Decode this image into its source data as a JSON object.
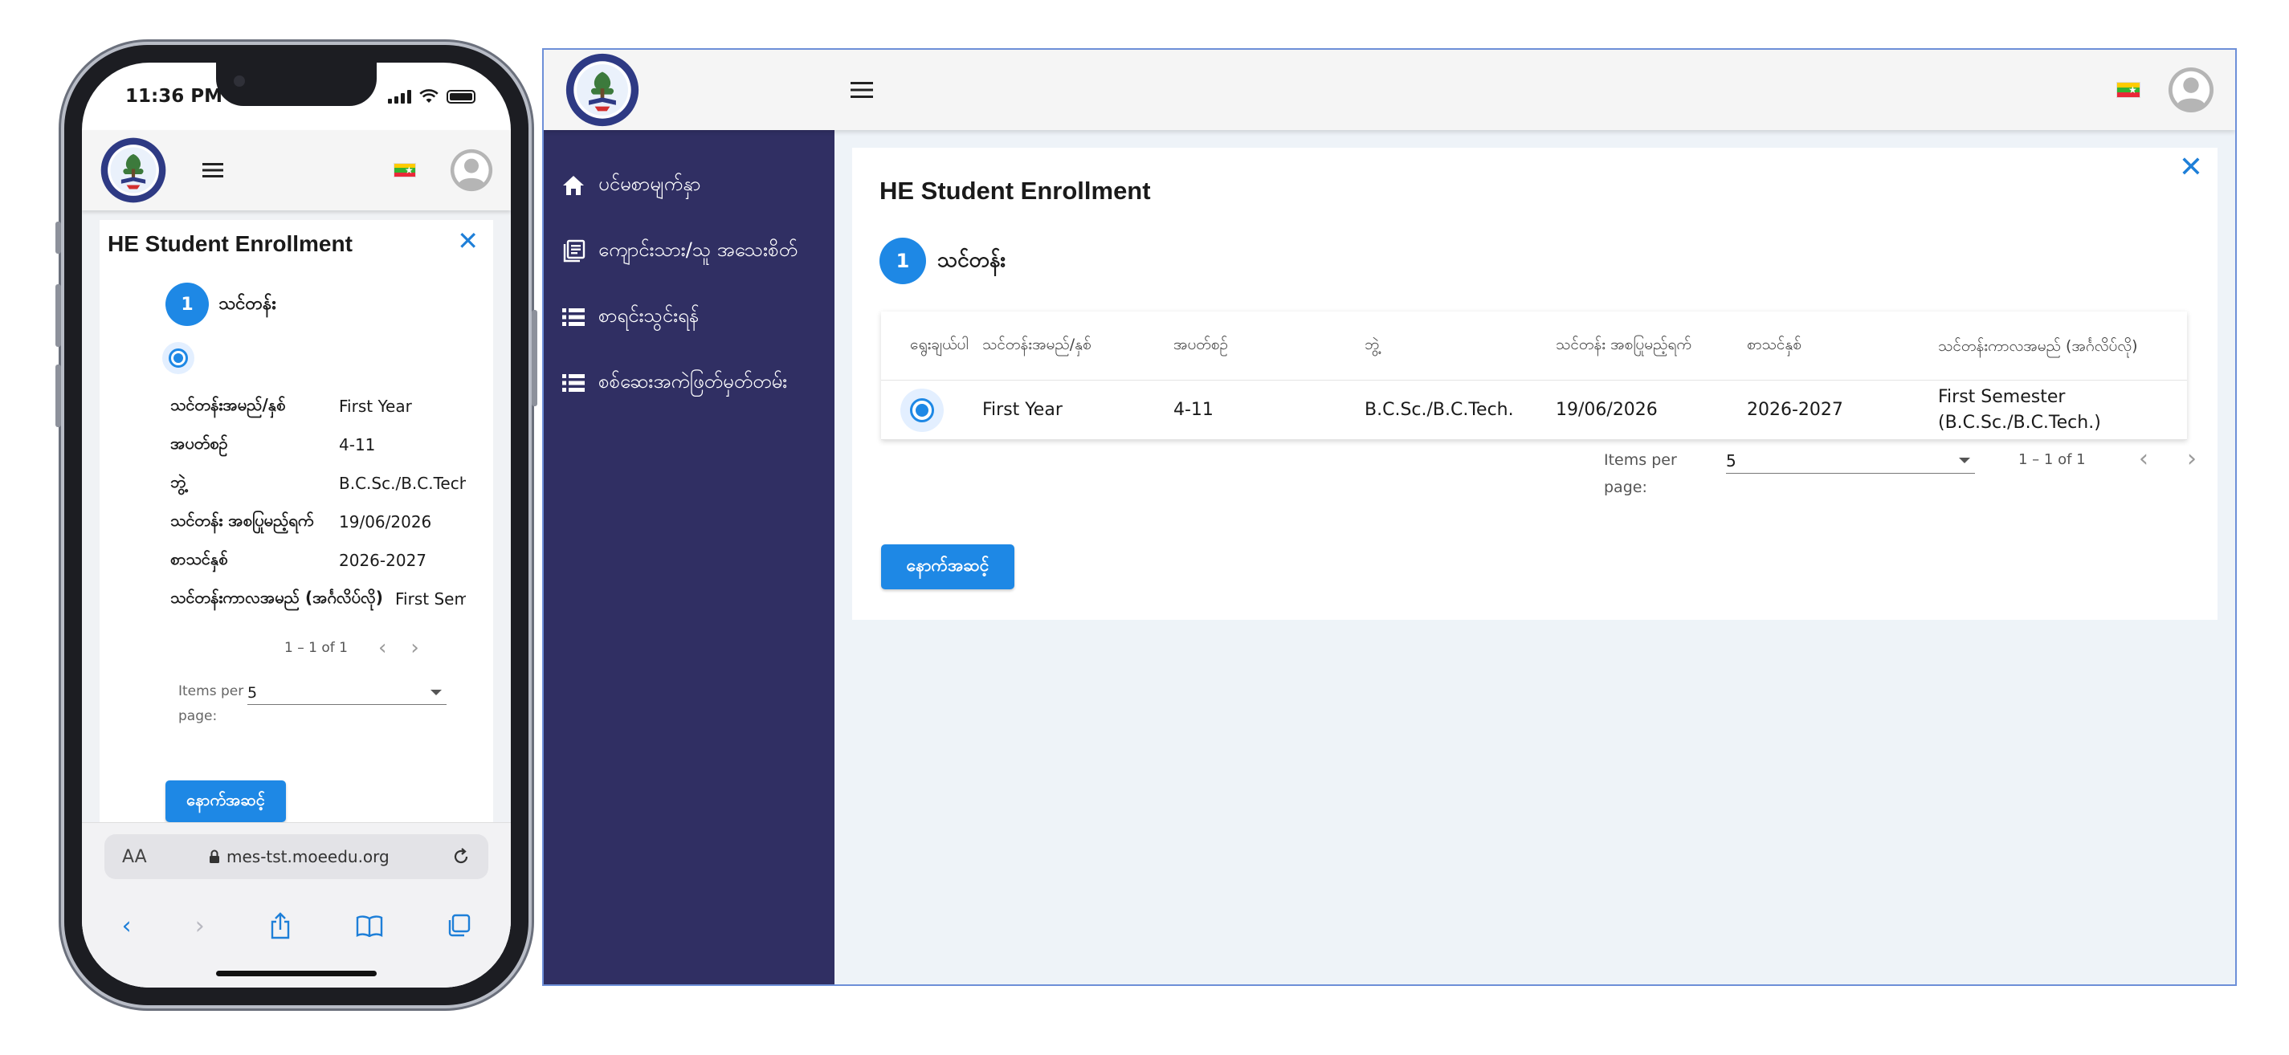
{
  "phone": {
    "status_time": "11:36 PM",
    "card_title": "HE Student Enrollment",
    "close_glyph": "✕",
    "step_number": "1",
    "step_label": "သင်တန်း",
    "rows": [
      {
        "label": "သင်တန်းအမည်/နှစ်",
        "value": "First Year"
      },
      {
        "label": "အပတ်စဥ်",
        "value": "4-11"
      },
      {
        "label": "ဘွဲ့",
        "value": "B.C.Sc./B.C.Tech."
      },
      {
        "label": "သင်တန်း အစပြုမည့်ရက်",
        "value": "19/06/2026"
      },
      {
        "label": "စာသင်နှစ်",
        "value": "2026-2027"
      },
      {
        "label": "သင်တန်းကာလအမည် (အင်္ဂလိပ်လို)",
        "value": "First Semester"
      }
    ],
    "pager_range": "1 – 1 of 1",
    "items_per_page_label": "Items per page:",
    "items_per_page_value": "5",
    "back_button": "နောက်အဆင့်",
    "browser": {
      "aa": "AA",
      "url": "mes-tst.moeedu.org"
    }
  },
  "desktop": {
    "sidebar": {
      "items": [
        {
          "label": "ပင်မစာမျက်နှာ",
          "icon": "home-icon"
        },
        {
          "label": "ကျောင်းသား/သူ အသေးစိတ်",
          "icon": "document-list-icon"
        },
        {
          "label": "စာရင်းသွင်းရန်",
          "icon": "list-icon"
        },
        {
          "label": "စစ်ဆေးအကဲဖြတ်မှတ်တမ်း",
          "icon": "list-icon"
        }
      ]
    },
    "card_title": "HE Student Enrollment",
    "close_glyph": "✕",
    "step_number": "1",
    "step_label": "သင်တန်း",
    "table": {
      "headers": [
        "ရွေးချယ်ပါ",
        "သင်တန်းအမည်/နှစ်",
        "အပတ်စဥ်",
        "ဘွဲ့",
        "သင်တန်း အစပြုမည့်ရက်",
        "စာသင်နှစ်",
        "သင်တန်းကာလအမည် (အင်္ဂလိပ်လို)"
      ],
      "rows": [
        {
          "course": "First Year",
          "week": "4-11",
          "degree": "B.C.Sc./B.C.Tech.",
          "start_date": "19/06/2026",
          "academic_year": "2026-2027",
          "term": "First Semester (B.C.Sc./B.C.Tech.)"
        }
      ]
    },
    "items_per_page_label": "Items per page:",
    "items_per_page_value": "5",
    "pager_range": "1 – 1 of 1",
    "back_button": "နောက်အဆင့်"
  },
  "colors": {
    "sidebar": "#302f63",
    "primary": "#1e88e5",
    "page_bg": "#eef3f8"
  }
}
